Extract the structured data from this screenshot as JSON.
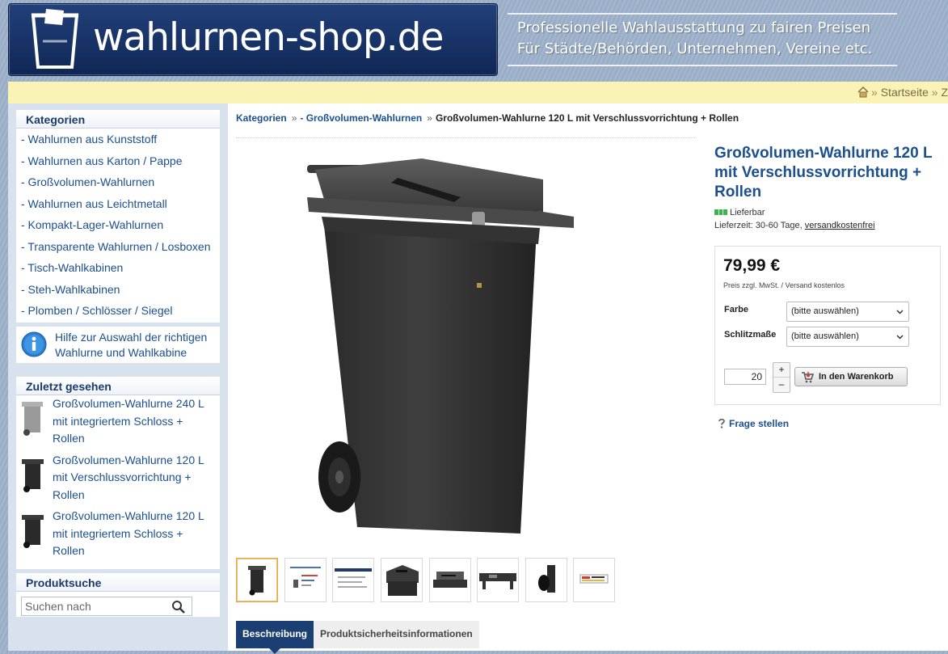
{
  "header": {
    "logo_text": "wahlurnen-shop.de",
    "tagline_line1": "Professionelle Wahlausstattung zu fairen Preisen",
    "tagline_line2": "Für Städte/Behörden, Unternehmen, Vereine etc."
  },
  "topnav": {
    "home_label": "Startseite",
    "next_label": "Z"
  },
  "sidebar": {
    "categories_title": "Kategorien",
    "categories": [
      "- Wahlurnen aus Kunststoff",
      "- Wahlurnen aus Karton / Pappe",
      "- Großvolumen-Wahlurnen",
      "- Wahlurnen aus Leichtmetall",
      "- Kompakt-Lager-Wahlurnen",
      "- Transparente Wahlurnen / Losboxen",
      "- Tisch-Wahlkabinen",
      "- Steh-Wahlkabinen",
      "- Plomben / Schlösser / Siegel"
    ],
    "help_line1": "Hilfe zur Auswahl der richtigen",
    "help_line2": "Wahlurne und Wahlkabine",
    "recent_title": "Zuletzt gesehen",
    "recent": [
      {
        "l1": "Großvolumen-Wahlurne 240 L",
        "l2": "mit integriertem Schloss +",
        "l3": "Rollen"
      },
      {
        "l1": "Großvolumen-Wahlurne 120 L",
        "l2": "mit Verschlussvorrichtung +",
        "l3": "Rollen"
      },
      {
        "l1": "Großvolumen-Wahlurne 120 L",
        "l2": "mit integriertem Schloss +",
        "l3": "Rollen"
      }
    ],
    "search_title": "Produktsuche",
    "search_placeholder": "Suchen nach"
  },
  "breadcrumb": {
    "root": "Kategorien",
    "category": "- Großvolumen-Wahlurnen",
    "current": "Großvolumen-Wahlurne 120 L mit Verschlussvorrichtung + Rollen",
    "separator": "»"
  },
  "product": {
    "title": "Großvolumen-Wahlurne 120 L mit Verschlussvorrichtung + Rollen",
    "stock": "Lieferbar",
    "delivery_prefix": "Lieferzeit: 30-60 Tage,",
    "shipping_link": "versandkostenfrei",
    "price": "79,99 €",
    "price_note": "Preis zzgl. MwSt. / Versand kostenlos",
    "option1_label": "Farbe",
    "option1_value": "(bitte auswählen)",
    "option2_label": "Schlitzmaße",
    "option2_value": "(bitte auswählen)",
    "quantity": "20",
    "plus": "+",
    "minus": "–",
    "cart_button": "In den Warenkorb",
    "question_link": "Frage stellen"
  },
  "tabs": [
    "Beschreibung",
    "Produktsicherheitsinformationen"
  ],
  "colors": {
    "brand_blue": "#1b3f73",
    "link_blue": "#1b4f8f",
    "topbar_yellow": "#fbf3b5",
    "stock_green": "#3ab54a"
  }
}
